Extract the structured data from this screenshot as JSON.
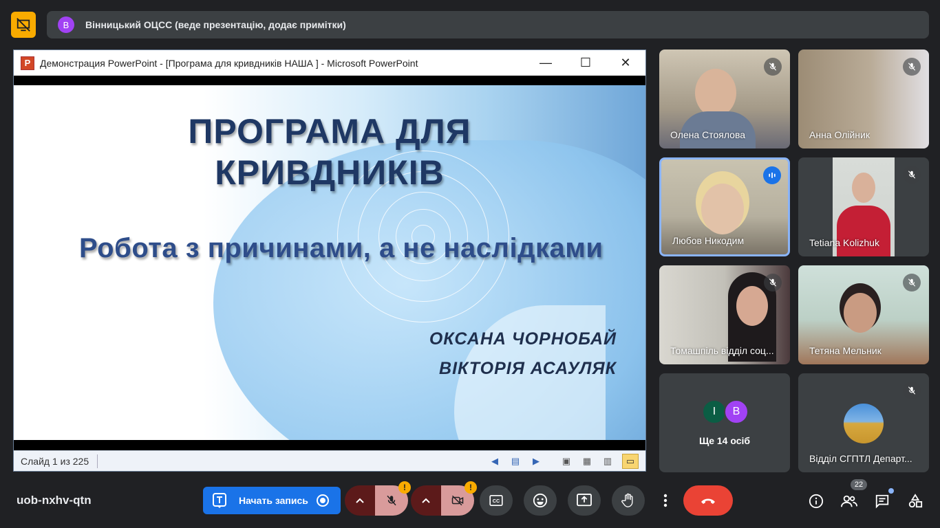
{
  "presenter_bar": {
    "avatar_letter": "В",
    "text": "Вінницький ОЦСС (веде презентацію, додає примітки)"
  },
  "ppt_window": {
    "title": "Демонстрация PowerPoint - [Програма для кривдників НАША  ] - Microsoft PowerPoint",
    "logo_letter": "P",
    "minimize": "—",
    "maximize": "☐",
    "close": "✕",
    "status_text": "Слайд 1 из 225"
  },
  "slide": {
    "title_line1": "ПРОГРАМА ДЛЯ",
    "title_line2": "КРИВДНИКІВ",
    "subtitle": "Робота  з причинами,  а не наслідками",
    "author1": "ОКСАНА ЧОРНОБАЙ",
    "author2": "ВІКТОРІЯ  АСАУЛЯК"
  },
  "participants": [
    {
      "name": "Олена Стоялова",
      "muted": true
    },
    {
      "name": "Анна Олійник",
      "muted": true
    },
    {
      "name": "Любов Никодим",
      "speaking": true
    },
    {
      "name": "Tetiana Kolizhuk",
      "muted": true
    },
    {
      "name": "Томашпіль відділ соц...",
      "muted": true
    },
    {
      "name": "Тетяна Мельник",
      "muted": true
    },
    {
      "name": "Відділ СГПТЛ Департ...",
      "muted": true
    }
  ],
  "others_tile": {
    "avatar1": "І",
    "avatar2": "В",
    "label": "Ще 14 осіб"
  },
  "bottom": {
    "meeting_code": "uob-nxhv-qtn",
    "record_label": "Начать запись",
    "people_count": "22",
    "warn_mark": "!"
  },
  "colors": {
    "background": "#202124",
    "accent_blue": "#1a73e8",
    "hangup_red": "#ea4335",
    "warning_yellow": "#f9ab00",
    "present_icon": "#f9ab00"
  }
}
